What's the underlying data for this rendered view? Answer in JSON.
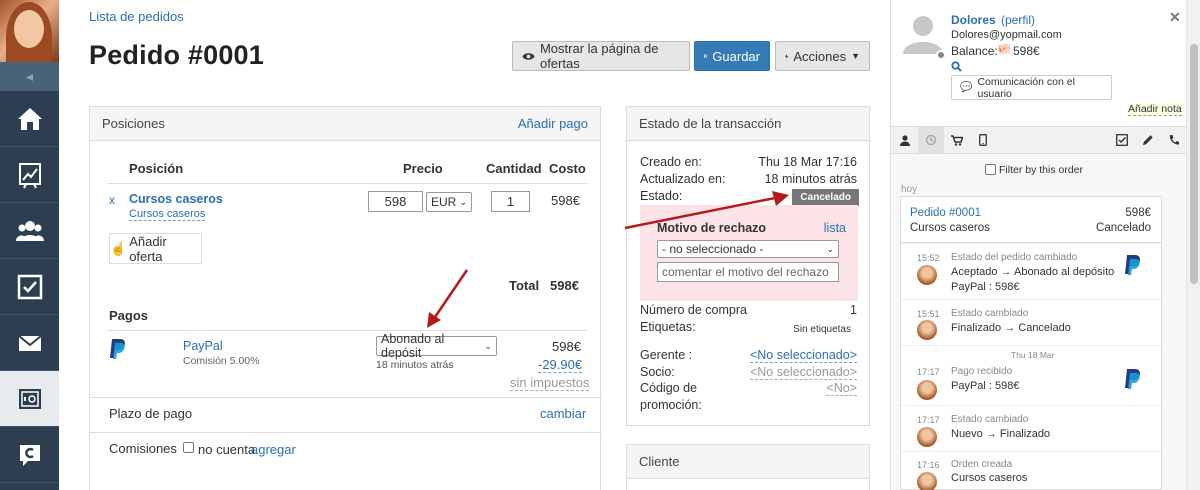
{
  "sidebar": {
    "items": [
      "home-icon",
      "chart-icon",
      "users-icon",
      "tasks-icon",
      "mail-icon",
      "safe-icon",
      "chat-logo-icon"
    ],
    "collapse_icon": "◂"
  },
  "header": {
    "breadcrumb": "Lista de pedidos",
    "title": "Pedido #0001"
  },
  "toolbar": {
    "offers_label": "Mostrar la página de ofertas",
    "save_label": "Guardar",
    "actions_label": "Acciones"
  },
  "positions": {
    "heading": "Posiciones",
    "add_payment": "Añadir pago",
    "columns": {
      "position": "Posición",
      "price": "Precio",
      "quantity": "Cantidad",
      "cost": "Costo"
    },
    "item": {
      "remove": "x",
      "name": "Cursos caseros",
      "sublink": "Cursos caseros",
      "price": "598",
      "currency": "EUR",
      "quantity": "1",
      "cost": "598€"
    },
    "add_offer": "Añadir oferta",
    "total_label": "Total",
    "total_value": "598€"
  },
  "payments": {
    "heading": "Pagos",
    "method": "PayPal",
    "commission": "Comisión 5.00%",
    "status": "Abonado al depósit",
    "time": "18 minutos atrás",
    "amount": "598€",
    "fee": "-29.90€",
    "taxes": "sin impuestos"
  },
  "payment_term": {
    "label": "Plazo de pago",
    "action": "cambiar"
  },
  "commissions": {
    "label": "Comisiones",
    "checkbox": "no cuenta",
    "add": "agregar"
  },
  "transaction": {
    "heading": "Estado de la transacción",
    "created_label": "Creado en:",
    "created_value": "Thu 18 Mar 17:16",
    "updated_label": "Actualizado en:",
    "updated_value": "18 minutos atrás",
    "status_label": "Estado:",
    "status_value": "Cancelado",
    "reject_title": "Motivo de rechazo",
    "reject_list": "lista",
    "reject_select": "- no seleccionado -",
    "reject_placeholder": "comentar el motivo del rechazo",
    "purchase_label": "Número de compra",
    "purchase_value": "1",
    "tags_label": "Etiquetas:",
    "tags_value": "Sin etiquetas",
    "manager_label": "Gerente :",
    "manager_value": "<No seleccionado>",
    "partner_label": "Socio:",
    "partner_value": "<No seleccionado>",
    "promo_label1": "Código de",
    "promo_label2": "promoción:",
    "promo_value": "<No>"
  },
  "client": {
    "heading": "Cliente"
  },
  "user": {
    "name": "Dolores",
    "profile": "(perfil)",
    "email": "Dolores@yopmail.com",
    "balance_label": "Balance:",
    "balance_value": "598€",
    "comm_button": "Comunicación con el usuario",
    "add_note": "Añadir nota"
  },
  "timeline": {
    "filter": "Filter by this order",
    "day_label": "hoy",
    "order": {
      "title": "Pedido #0001",
      "amount": "598€",
      "product": "Cursos caseros",
      "status": "Cancelado"
    },
    "events": [
      {
        "time": "15:52",
        "title": "Estado del pedido cambiado",
        "line1": "Aceptado → Abonado al depósito",
        "line2": "PayPal : 598€",
        "paypal": true
      },
      {
        "time": "15:51",
        "title": "Estado cambiado",
        "line1": "Finalizado → Cancelado",
        "line2": "",
        "paypal": false
      },
      {
        "time": "17:17",
        "title": "Pago recibido",
        "line1": "PayPal : 598€",
        "line2": "",
        "paypal": true
      },
      {
        "time": "17:17",
        "title": "Estado cambiado",
        "line1": "Nuevo → Finalizado",
        "line2": "",
        "paypal": false
      },
      {
        "time": "17:16",
        "title": "Orden creada",
        "line1": "Cursos caseros",
        "line2": "",
        "paypal": false
      }
    ],
    "date_sep": "Thu 18 Mar"
  },
  "colors": {
    "sidebar": "#2c3e50",
    "primary": "#337ab7",
    "link": "#2a6fb6",
    "danger_arrow": "#b31b1b",
    "reject_bg": "#fbe3e8",
    "badge": "#777777"
  }
}
